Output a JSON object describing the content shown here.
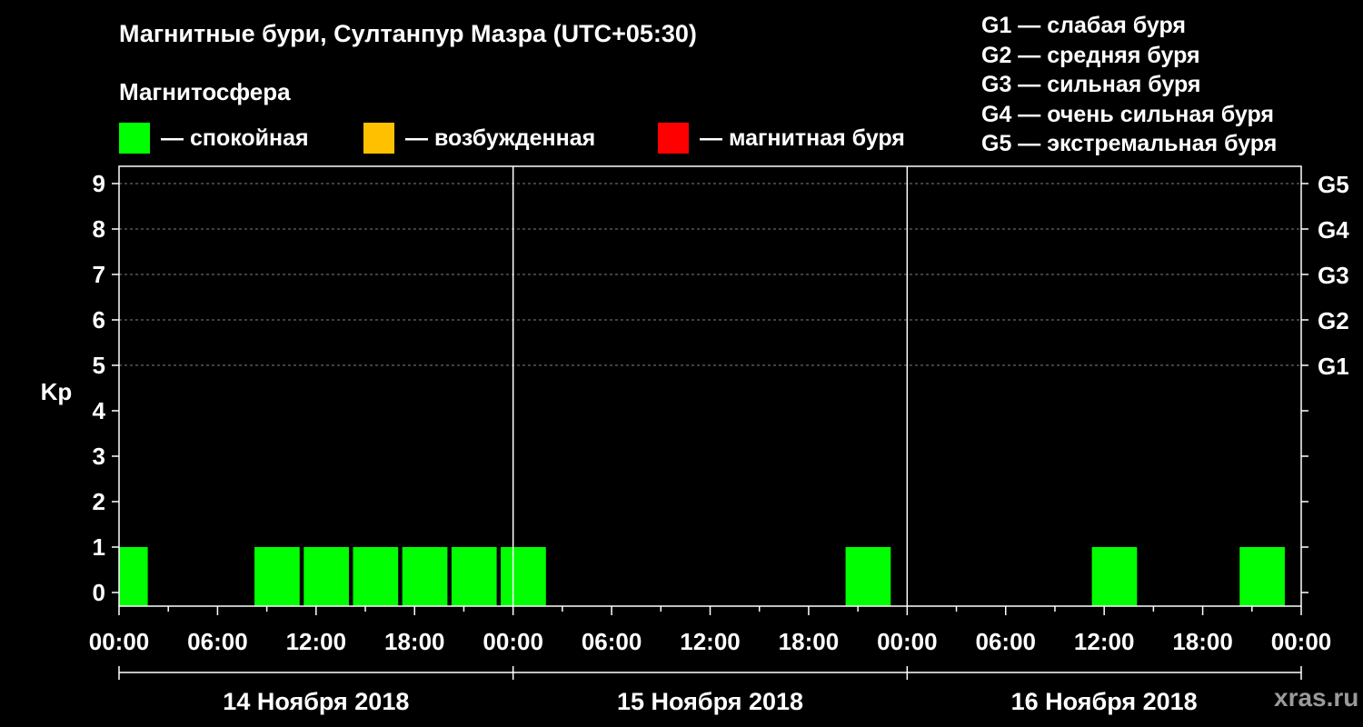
{
  "header": {
    "title": "Магнитные бури, Султанпур Мазра (UTC+05:30)",
    "subtitle": "Магнитосфера"
  },
  "legend": [
    {
      "label": "— спокойная",
      "color": "#00ff00"
    },
    {
      "label": "— возбужденная",
      "color": "#ffc000"
    },
    {
      "label": "— магнитная буря",
      "color": "#ff0000"
    }
  ],
  "g_legend": [
    "G1 — слабая буря",
    "G2 — средняя буря",
    "G3 — сильная буря",
    "G4 — очень сильная буря",
    "G5 — экстремальная буря"
  ],
  "watermark": "xras.ru",
  "chart_data": {
    "type": "bar",
    "ylabel": "Kp",
    "ylim": [
      0,
      9
    ],
    "yticks": [
      "0",
      "1",
      "2",
      "3",
      "4",
      "5",
      "6",
      "7",
      "8",
      "9"
    ],
    "right_axis": [
      {
        "label": "G1",
        "kp": 5
      },
      {
        "label": "G2",
        "kp": 6
      },
      {
        "label": "G3",
        "kp": 7
      },
      {
        "label": "G4",
        "kp": 8
      },
      {
        "label": "G5",
        "kp": 9
      }
    ],
    "xlim_hours": [
      0,
      72
    ],
    "xticks": [
      "00:00",
      "06:00",
      "12:00",
      "18:00",
      "00:00",
      "06:00",
      "12:00",
      "18:00",
      "00:00",
      "06:00",
      "12:00",
      "18:00",
      "00:00"
    ],
    "days": [
      "14 Ноября 2018",
      "15 Ноября 2018",
      "16 Ноября 2018"
    ],
    "grid": true,
    "bars": [
      {
        "start_hour": 0,
        "end_hour": 1.75,
        "kp": 1,
        "color": "#00ff00"
      },
      {
        "start_hour": 8.25,
        "end_hour": 11,
        "kp": 1,
        "color": "#00ff00"
      },
      {
        "start_hour": 11.25,
        "end_hour": 14,
        "kp": 1,
        "color": "#00ff00"
      },
      {
        "start_hour": 14.25,
        "end_hour": 17,
        "kp": 1,
        "color": "#00ff00"
      },
      {
        "start_hour": 17.25,
        "end_hour": 20,
        "kp": 1,
        "color": "#00ff00"
      },
      {
        "start_hour": 20.25,
        "end_hour": 23,
        "kp": 1,
        "color": "#00ff00"
      },
      {
        "start_hour": 23.25,
        "end_hour": 26,
        "kp": 1,
        "color": "#00ff00"
      },
      {
        "start_hour": 44.25,
        "end_hour": 47,
        "kp": 1,
        "color": "#00ff00"
      },
      {
        "start_hour": 59.25,
        "end_hour": 62,
        "kp": 1,
        "color": "#00ff00"
      },
      {
        "start_hour": 68.25,
        "end_hour": 71,
        "kp": 1,
        "color": "#00ff00"
      }
    ]
  }
}
